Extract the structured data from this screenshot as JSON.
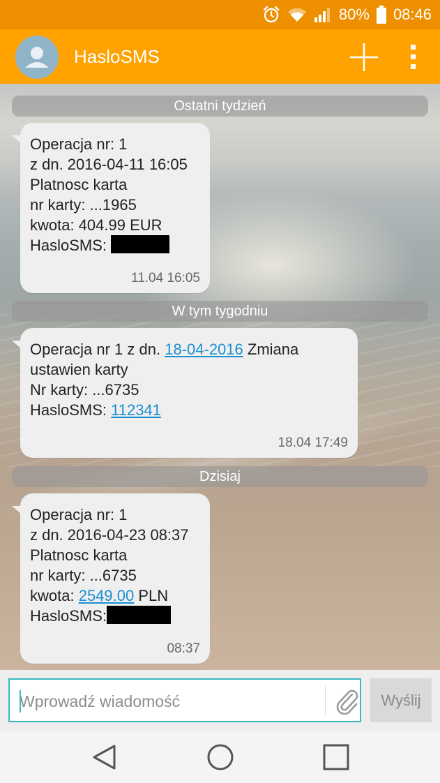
{
  "status_bar": {
    "battery_percent": "80%",
    "time": "08:46",
    "icons": [
      "alarm-icon",
      "wifi-icon",
      "signal-icon",
      "battery-icon"
    ]
  },
  "app_bar": {
    "title": "HasloSMS",
    "icons": [
      "contact-avatar-icon",
      "add-icon",
      "overflow-menu-icon"
    ],
    "color": "#ffa200"
  },
  "conversation": {
    "groups": [
      {
        "separator": "Ostatni tydzień",
        "message": {
          "lines": [
            "Operacja nr: 1",
            "z dn. 2016-04-11 16:05",
            "Platnosc karta",
            "nr karty: ...1965",
            "kwota: 404.99 EUR",
            "HasloSMS: "
          ],
          "time": "11.04 16:05"
        }
      },
      {
        "separator": "W tym tygodniu",
        "message": {
          "l1_prefix": "Operacja nr 1 z dn. ",
          "l1_link": "18-04-2016",
          "l1_suffix": " Zmiana",
          "l2": "ustawien karty",
          "l3": "Nr karty: ...6735",
          "l4_prefix": "HasloSMS: ",
          "l4_link": "112341",
          "time": "18.04 17:49"
        }
      },
      {
        "separator": "Dzisiaj",
        "message": {
          "l1": "Operacja nr: 1",
          "l2": "z dn. 2016-04-23 08:37",
          "l3": "Platnosc karta",
          "l4": "nr karty: ...6735",
          "l5_prefix": "kwota: ",
          "l5_link": "2549.00",
          "l5_suffix": " PLN",
          "l6": "HasloSMS:",
          "time": "08:37"
        }
      }
    ]
  },
  "composer": {
    "placeholder": "Wprowadź wiadomość",
    "send_label": "Wyślij",
    "accent": "#3cb8c4",
    "link_color": "#1a8fd1"
  },
  "nav_bar": {
    "icons": [
      "back-icon",
      "home-icon",
      "recents-icon"
    ]
  }
}
